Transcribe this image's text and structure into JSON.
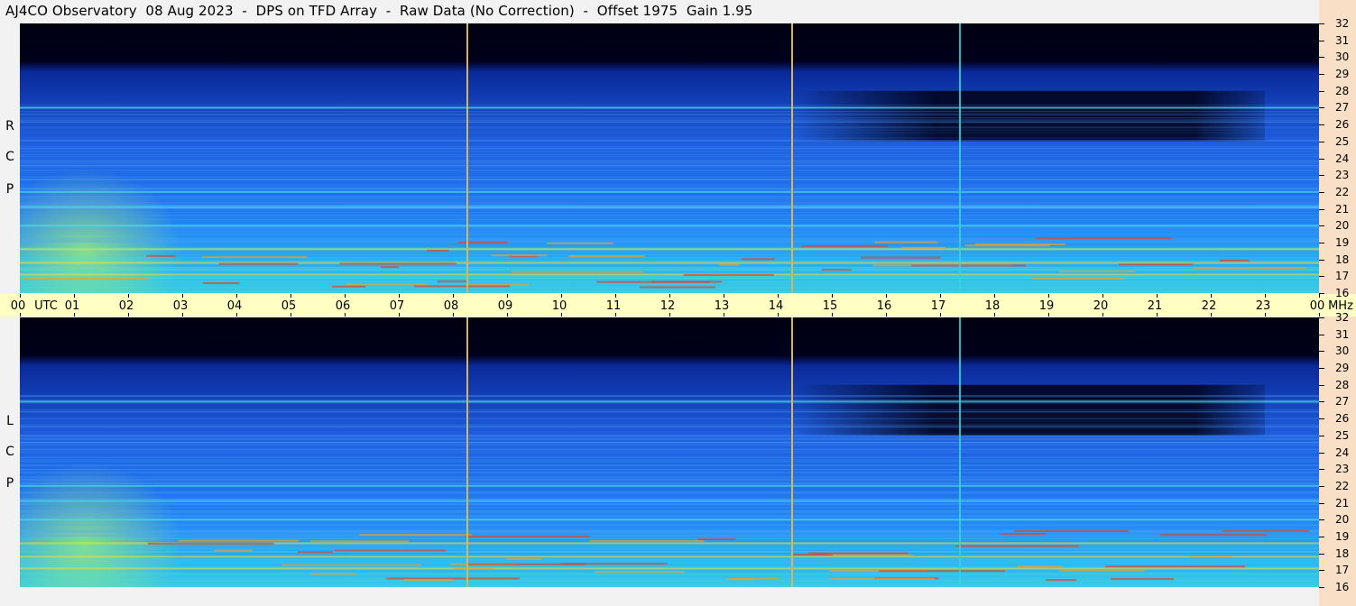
{
  "title": "AJ4CO Observatory  08 Aug 2023  -  DPS on TFD Array  -  Raw Data (No Correction)  -  Offset 1975  Gain 1.95",
  "chart_data": [
    {
      "type": "heatmap",
      "name": "RCP",
      "polarization_label": [
        "R",
        "C",
        "P"
      ],
      "x_unit": "UTC",
      "y_unit": "MHz",
      "xlim": [
        0,
        24
      ],
      "ylim": [
        16,
        32
      ],
      "vertical_markers_utc": [
        8.25,
        14.25,
        17.35
      ],
      "bright_bands_mhz": [
        17.1,
        17.8,
        18.6,
        20.0,
        21.1,
        22.0,
        27.0
      ]
    },
    {
      "type": "heatmap",
      "name": "LCP",
      "polarization_label": [
        "L",
        "C",
        "P"
      ],
      "x_unit": "UTC",
      "y_unit": "MHz",
      "xlim": [
        0,
        24
      ],
      "ylim": [
        16,
        32
      ],
      "vertical_markers_utc": [
        8.25,
        14.25,
        17.35
      ],
      "bright_bands_mhz": [
        17.1,
        17.8,
        18.6,
        20.0,
        21.1,
        22.0,
        27.0
      ]
    }
  ],
  "time_axis": {
    "labels": [
      "00",
      "01",
      "02",
      "03",
      "04",
      "05",
      "06",
      "07",
      "08",
      "09",
      "10",
      "11",
      "12",
      "13",
      "14",
      "15",
      "16",
      "17",
      "18",
      "19",
      "20",
      "21",
      "22",
      "23",
      "00"
    ],
    "utc_label": "UTC",
    "mhz_label": "MHz"
  },
  "freq_axis": {
    "labels": [
      "32",
      "31",
      "30",
      "29",
      "28",
      "27",
      "26",
      "25",
      "24",
      "23",
      "22",
      "21",
      "20",
      "19",
      "18",
      "17",
      "16"
    ]
  },
  "colors": {
    "background": "#f2f2f2",
    "timebar": "#ffffc4",
    "right_strip": "#f8dfc6",
    "marker": "#d9b45a",
    "cyan_line": "#35d6d6"
  }
}
